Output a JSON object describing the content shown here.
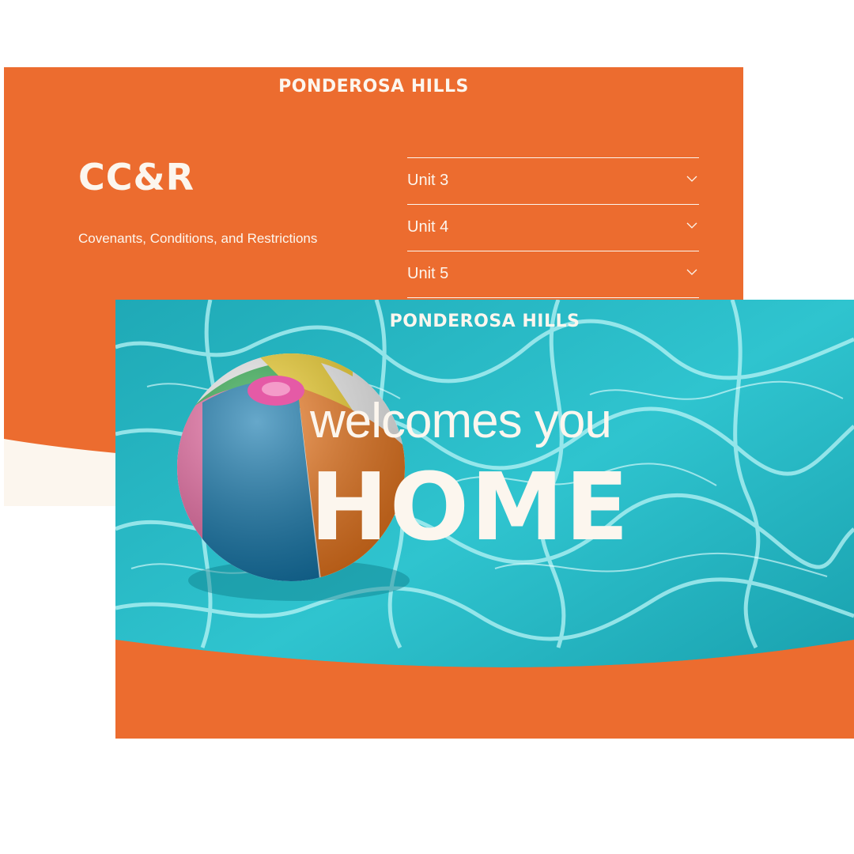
{
  "back_card": {
    "brand": "PONDEROSA HILLS",
    "title": "CC&R",
    "subtitle": "Covenants, Conditions, and Restrictions",
    "accordion": [
      {
        "label": "Unit 3",
        "icon": "chevron-down-icon"
      },
      {
        "label": "Unit 4",
        "icon": "chevron-down-icon"
      },
      {
        "label": "Unit 5",
        "icon": "chevron-down-icon"
      }
    ]
  },
  "front_card": {
    "brand": "PONDEROSA HILLS",
    "welcome": "welcomes you",
    "headline": "HOME"
  },
  "colors": {
    "orange": "#EC6C2F",
    "cream": "#FCF6EE",
    "water": "#2FC4CF"
  }
}
